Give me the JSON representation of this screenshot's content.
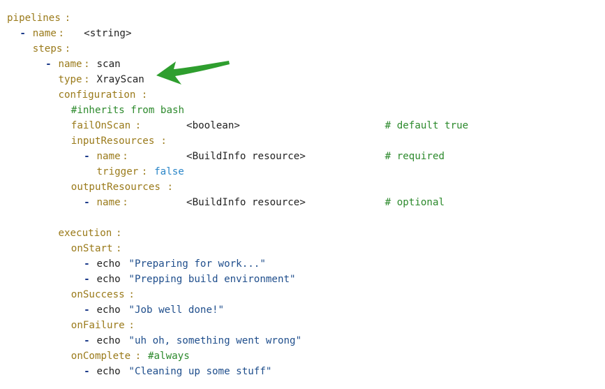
{
  "lines": [
    {
      "indent": 0,
      "key": "pipelines",
      "colon": ":"
    },
    {
      "indent": 2,
      "dash": "-",
      "key": "name",
      "colon": ":",
      "value": "<string>"
    },
    {
      "indent": 4,
      "key": "steps",
      "colon": ":"
    },
    {
      "indent": 6,
      "dash": "-",
      "key": "name",
      "colon": ":",
      "value": "scan"
    },
    {
      "indent": 8,
      "key": "type",
      "colon": ":",
      "value": "XrayScan"
    },
    {
      "indent": 8,
      "key": "configuration",
      "colon": ":"
    },
    {
      "indent": 10,
      "comment": "#inherits from bash"
    },
    {
      "indent": 10,
      "key": "failOnScan",
      "colon": ":",
      "value": "<boolean>",
      "trailing": "# default true"
    },
    {
      "indent": 10,
      "key": "inputResources",
      "colon": ":"
    },
    {
      "indent": 12,
      "dash": "-",
      "key": "name",
      "colon": ":",
      "value": "<BuildInfo resource>",
      "trailing": "# required"
    },
    {
      "indent": 14,
      "key": "trigger",
      "colon": ":",
      "value": "false",
      "value_class": "bl"
    },
    {
      "indent": 10,
      "key": "outputResources",
      "colon": ":"
    },
    {
      "indent": 12,
      "dash": "-",
      "key": "name",
      "colon": ":",
      "value": "<BuildInfo resource>",
      "trailing": "# optional"
    },
    {},
    {
      "indent": 8,
      "key": "execution",
      "colon": ":"
    },
    {
      "indent": 10,
      "key": "onStart",
      "colon": ":"
    },
    {
      "indent": 12,
      "dash": "-",
      "value": "echo",
      "str": "\"Preparing for work...\""
    },
    {
      "indent": 12,
      "dash": "-",
      "value": "echo",
      "str": "\"Prepping build environment\""
    },
    {
      "indent": 10,
      "key": "onSuccess",
      "colon": ":"
    },
    {
      "indent": 12,
      "dash": "-",
      "value": "echo",
      "str": "\"Job well done!\""
    },
    {
      "indent": 10,
      "key": "onFailure",
      "colon": ":"
    },
    {
      "indent": 12,
      "dash": "-",
      "value": "echo",
      "str": "\"uh oh, something went wrong\""
    },
    {
      "indent": 10,
      "key": "onComplete",
      "colon": ":",
      "comment": "#always"
    },
    {
      "indent": 12,
      "dash": "-",
      "value": "echo",
      "str": "\"Cleaning up some stuff\""
    }
  ],
  "colors": {
    "key": "#9a7a1a",
    "dash": "#1c3b8a",
    "string": "#1f4e8c",
    "comment": "#2d8a2d",
    "boolean": "#2b86c8",
    "arrow": "#2e9e2e"
  },
  "annotation": {
    "icon": "green-arrow-icon",
    "points_to": "type: XrayScan"
  }
}
